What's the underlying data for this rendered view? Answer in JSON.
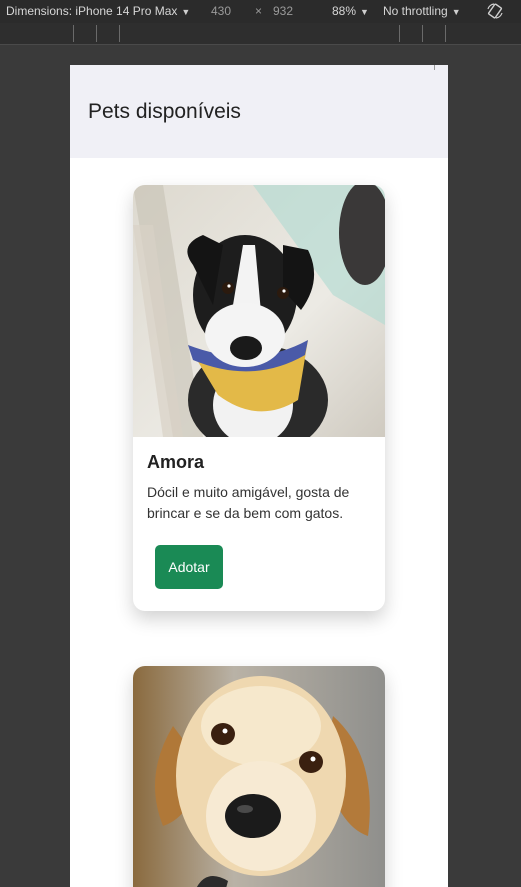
{
  "devtools": {
    "dimensions_label": "Dimensions: iPhone 14 Pro Max",
    "width": "430",
    "times": "×",
    "height": "932",
    "zoom": "88%",
    "throttling": "No throttling",
    "icons": {
      "rotate": "rotate-icon",
      "dropdown": "caret-down-icon"
    }
  },
  "page": {
    "title": "Pets disponíveis"
  },
  "pets": [
    {
      "name": "Amora",
      "description": "Dócil e muito amigável, gosta de brincar e se da bem com gatos.",
      "button": "Adotar"
    },
    {
      "name": "",
      "description": "",
      "button": ""
    }
  ],
  "colors": {
    "header_bg": "#f0f0f6",
    "button_bg": "#1a8a55"
  }
}
